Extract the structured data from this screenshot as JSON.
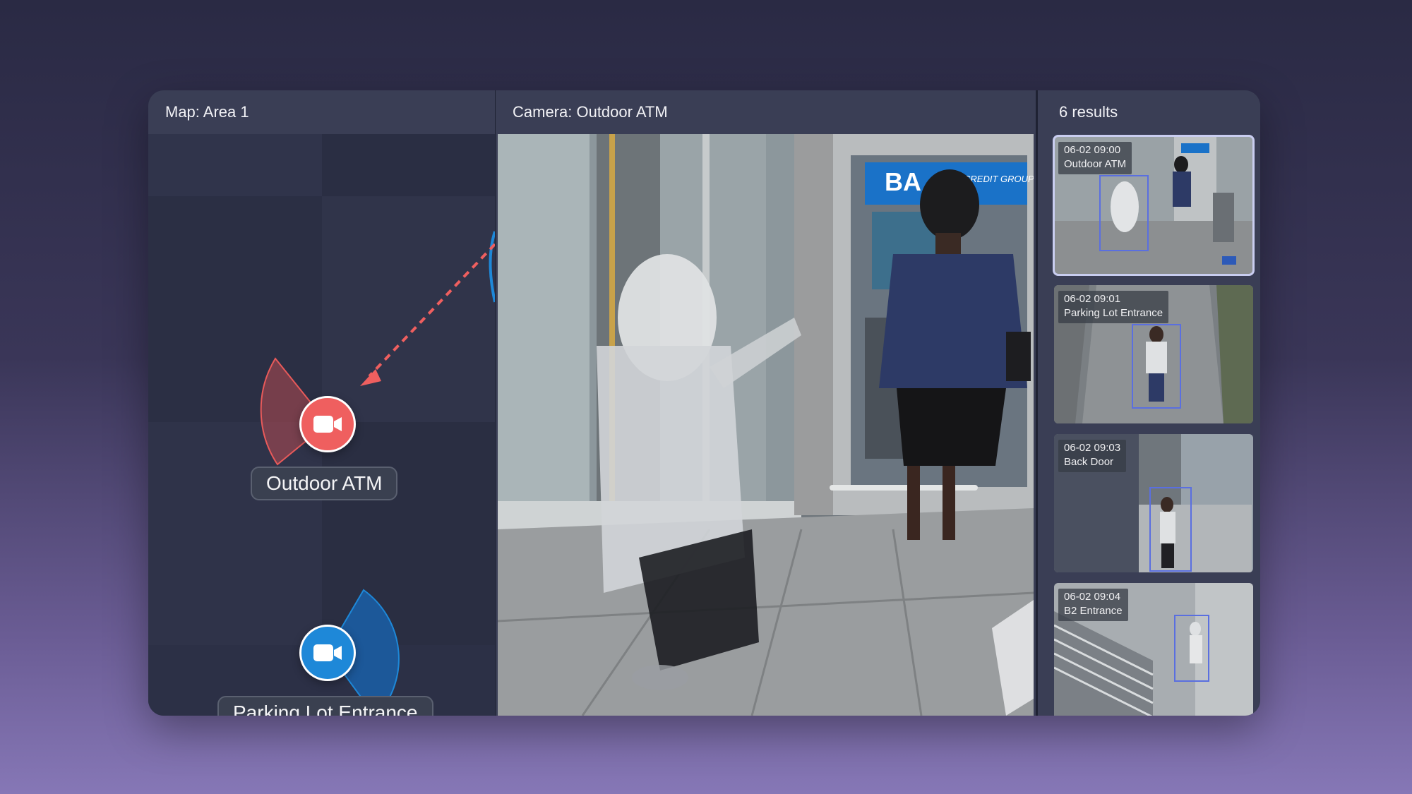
{
  "map": {
    "title": "Map: Area 1",
    "cameras": [
      {
        "label": "Outdoor ATM",
        "icon": "video-camera-icon",
        "color": "#ef5f5f",
        "state": "active"
      },
      {
        "label": "Parking Lot Entrance",
        "icon": "video-camera-icon",
        "color": "#1e88d8",
        "state": "inactive"
      }
    ]
  },
  "camera": {
    "title": "Camera: Outdoor ATM",
    "atm_sign": "BA",
    "atm_sign_sub": "CREDIT GROUP"
  },
  "results": {
    "title": "6 results",
    "items": [
      {
        "time": "06-02 09:00",
        "location": "Outdoor ATM"
      },
      {
        "time": "06-02 09:01",
        "location": "Parking Lot Entrance"
      },
      {
        "time": "06-02 09:03",
        "location": "Back Door"
      },
      {
        "time": "06-02 09:04",
        "location": "B2 Entrance"
      }
    ]
  },
  "colors": {
    "accent_red": "#ef5f5f",
    "accent_blue": "#1e88d8",
    "detection_box": "#5a6fe0"
  }
}
